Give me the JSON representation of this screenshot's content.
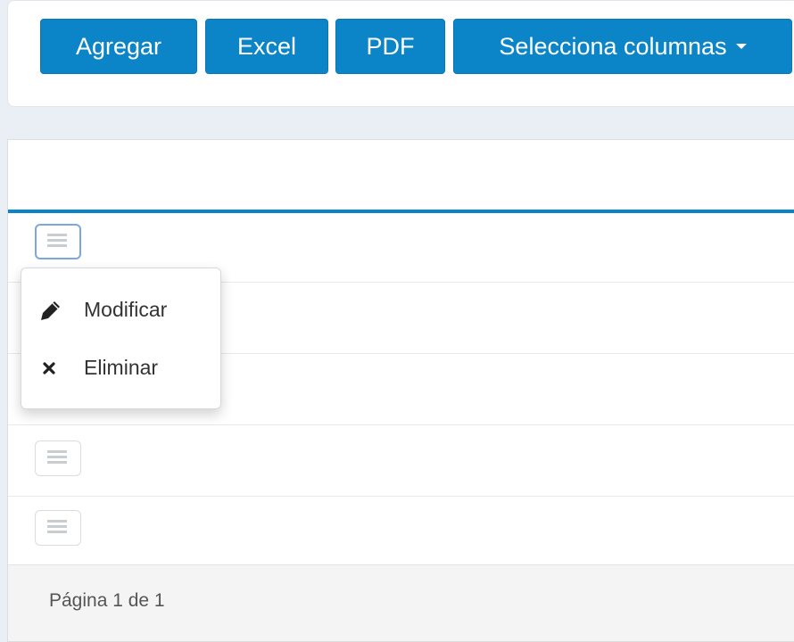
{
  "toolbar": {
    "add_label": "Agregar",
    "excel_label": "Excel",
    "pdf_label": "PDF",
    "columns_label": "Selecciona columnas"
  },
  "row_actions_menu": {
    "items": [
      {
        "label": "Modificar",
        "icon": "pencil-icon"
      },
      {
        "label": "Eliminar",
        "icon": "close-icon"
      }
    ]
  },
  "table": {
    "rows": [
      {
        "icon": "menu-icon"
      },
      {
        "icon": "menu-icon"
      },
      {
        "icon": "menu-icon"
      },
      {
        "icon": "menu-icon"
      },
      {
        "icon": "menu-icon"
      }
    ]
  },
  "pagination": {
    "text": "Página 1 de 1"
  },
  "colors": {
    "primary": "#0b85c8",
    "background": "#e9eff5",
    "table_accent": "#0b85c8"
  }
}
